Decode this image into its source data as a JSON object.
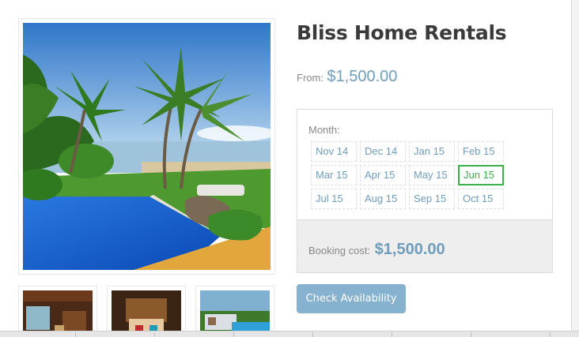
{
  "property": {
    "title": "Bliss Home Rentals",
    "from_label": "From:",
    "from_price": "$1,500.00"
  },
  "gallery": {
    "main_image": "resort-pool-beach-photo",
    "thumbnails": [
      "living-room-photo",
      "bedroom-photo",
      "pool-photo"
    ]
  },
  "booking": {
    "month_label": "Month:",
    "months": [
      "Nov 14",
      "Dec 14",
      "Jan 15",
      "Feb 15",
      "Mar 15",
      "Apr 15",
      "May 15",
      "Jun 15",
      "Jul 15",
      "Aug 15",
      "Sep 15",
      "Oct 15"
    ],
    "selected_month": "Jun 15",
    "cost_label": "Booking cost:",
    "cost_value": "$1,500.00"
  },
  "actions": {
    "check_label": "Check Availability"
  },
  "colors": {
    "accent": "#6f9dbd",
    "button": "#86b2cf",
    "selected": "#3cb04a"
  }
}
